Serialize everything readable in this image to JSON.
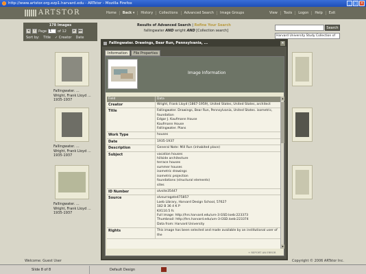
{
  "window": {
    "title": "http://www.artstor.org.ezp1.harvard.edu - ARTstor - Mozilla Firefox"
  },
  "header": {
    "logo": "ARTSTOR",
    "nav": [
      "Home",
      "Back",
      "History",
      "Collections",
      "Advanced Search",
      "Image Groups",
      "View",
      "Tools",
      "Logon",
      "Help",
      "Exit"
    ]
  },
  "toolbar": {
    "image_count": "178 Images",
    "page_label": "Page",
    "page_value": "1",
    "page_of": "of 12",
    "sort_label": "Sort by:",
    "sort_title": "Title",
    "sort_creator": "Creator",
    "sort_date": "Date"
  },
  "results": {
    "heading": "Results of Advanced Search",
    "refine": "Refine Your Search",
    "query_a": "fallingwater",
    "op1": "AND",
    "query_b": "wright",
    "op2": "AND",
    "query_c": "[Collection search]"
  },
  "search": {
    "button": "Search",
    "collection": "Harvard University Study Collection of"
  },
  "thumbnails": [
    {
      "title": "Fallingwater. ...",
      "creator": "Wright, Frank Lloyd ...",
      "date": "1935-1937"
    },
    {
      "title": "Fallingwater. ...",
      "creator": "Wright, Frank Lloyd ...",
      "date": "1935-1937"
    },
    {
      "title": "Fallingwater. ...",
      "creator": "Wright, Frank Lloyd ...",
      "date": "1935-1937"
    }
  ],
  "modal": {
    "title": "Fallingwater. Drawings, Bear Run, Pennsylvania, ...",
    "tabs": [
      "Information",
      "File Properties"
    ],
    "image_info": "Image Information",
    "col_field": "Field",
    "col_data": "Data",
    "rows": [
      {
        "k": "Creator",
        "v": "Wright, Frank Lloyd (1867-1959), United States, United States, architect"
      },
      {
        "k": "Title",
        "v": "Fallingwater. Drawings, Bear Run, Pennsylvania, United States. isometric, foundation\nEdgar J. Kaufmann House\nKaufmann House\nFallingwater. Plans"
      },
      {
        "k": "Work Type",
        "v": "houses"
      },
      {
        "k": "Date",
        "v": "1935-1937"
      },
      {
        "k": "Description",
        "v": "General Note: Mill Run (inhabited place)"
      },
      {
        "k": "Subject",
        "v": "vacation houses\nhillside architecture\nterrace houses\nsummer houses\nisometric drawings\nisometric projection\nfoundations (structural elements)\nsites"
      },
      {
        "k": "ID Number",
        "v": "olvsite35447"
      },
      {
        "k": "Source",
        "v": "olvsurrogate475857\nLoeb Library, Harvard Design School, 57627\n182 B 36 4 K P\nKX110.5 fs\nFull image: http://hrs.harvard.edu/urn-3:GSD.loeb:223373\nThumbnail: http://hrs.harvard.edu/urn-3:GSD.loeb:223374\nData from: Harvard University"
      },
      {
        "k": "Rights",
        "v": "This image has been selected and made available by an institutional user of the"
      }
    ],
    "report": "+ REPORT AN ERROR"
  },
  "footer": {
    "welcome": "Welcome:  Guest User",
    "copyright": "Copyright © 2006 ARTstor Inc.",
    "status_slide": "Slide 8 of 8",
    "status_design": "Default Design"
  }
}
